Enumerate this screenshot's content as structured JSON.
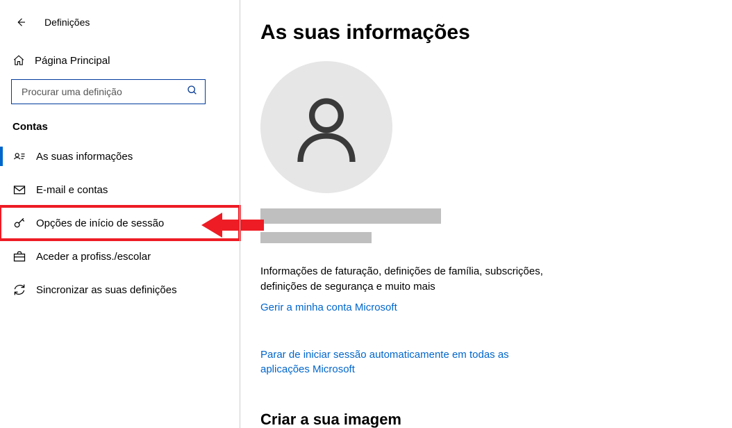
{
  "header": {
    "settings_label": "Definições"
  },
  "sidebar": {
    "home_label": "Página Principal",
    "search_placeholder": "Procurar uma definição",
    "section_title": "Contas",
    "items": [
      {
        "label": "As suas informações"
      },
      {
        "label": "E-mail e contas"
      },
      {
        "label": "Opções de início de sessão"
      },
      {
        "label": "Aceder a profiss./escolar"
      },
      {
        "label": "Sincronizar as suas definições"
      }
    ]
  },
  "main": {
    "title": "As suas informações",
    "billing_info": "Informações de faturação, definições de família, subscrições, definições de segurança e muito mais",
    "manage_link": "Gerir a minha conta Microsoft",
    "stop_signin_link": "Parar de iniciar sessão automaticamente em todas as aplicações Microsoft",
    "create_image_heading": "Criar a sua imagem"
  }
}
